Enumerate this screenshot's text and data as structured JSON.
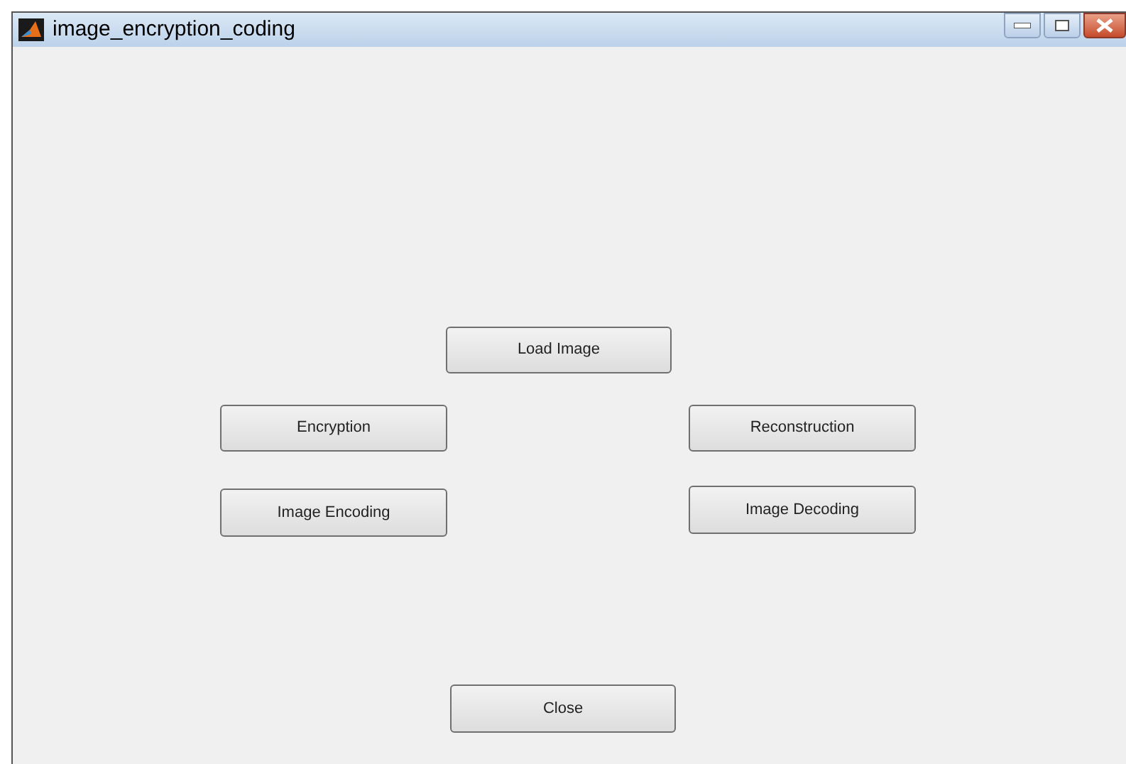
{
  "window": {
    "title": "image_encryption_coding"
  },
  "buttons": [
    {
      "label": "Load Image"
    },
    {
      "label": "Encryption"
    },
    {
      "label": "Reconstruction"
    },
    {
      "label": "Image Encoding"
    },
    {
      "label": "Image Decoding"
    },
    {
      "label": "Close"
    }
  ]
}
